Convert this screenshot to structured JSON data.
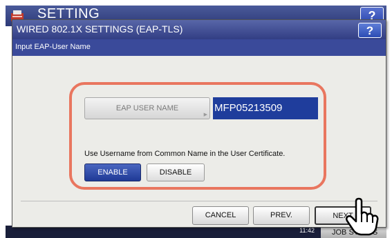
{
  "background": {
    "title": "SETTING",
    "help_label": "?",
    "clock_line1": "",
    "clock_line2": "11:42",
    "job_status_label": "JOB STATUS"
  },
  "dialog": {
    "title": "WIRED 802.1X SETTINGS (EAP-TLS)",
    "help_label": "?",
    "subtitle": "Input EAP-User Name",
    "field": {
      "label": "EAP USER NAME",
      "value": "MFP05213509"
    },
    "instruction": "Use Username from Common Name in the User Certificate.",
    "toggle": {
      "enable_label": "ENABLE",
      "disable_label": "DISABLE",
      "selected": "ENABLE"
    },
    "buttons": {
      "cancel_label": "CANCEL",
      "prev_label": "PREV.",
      "next_label": "NEXT"
    }
  },
  "colors": {
    "title_bar": "#3a4a9a",
    "field_value_bg": "#1f3d9c",
    "highlight_ring": "#e9765f",
    "enable_selected": "#1f3a96"
  },
  "icons": {
    "app": "setting-app-icon",
    "pointer": "hand-pointer-icon"
  }
}
